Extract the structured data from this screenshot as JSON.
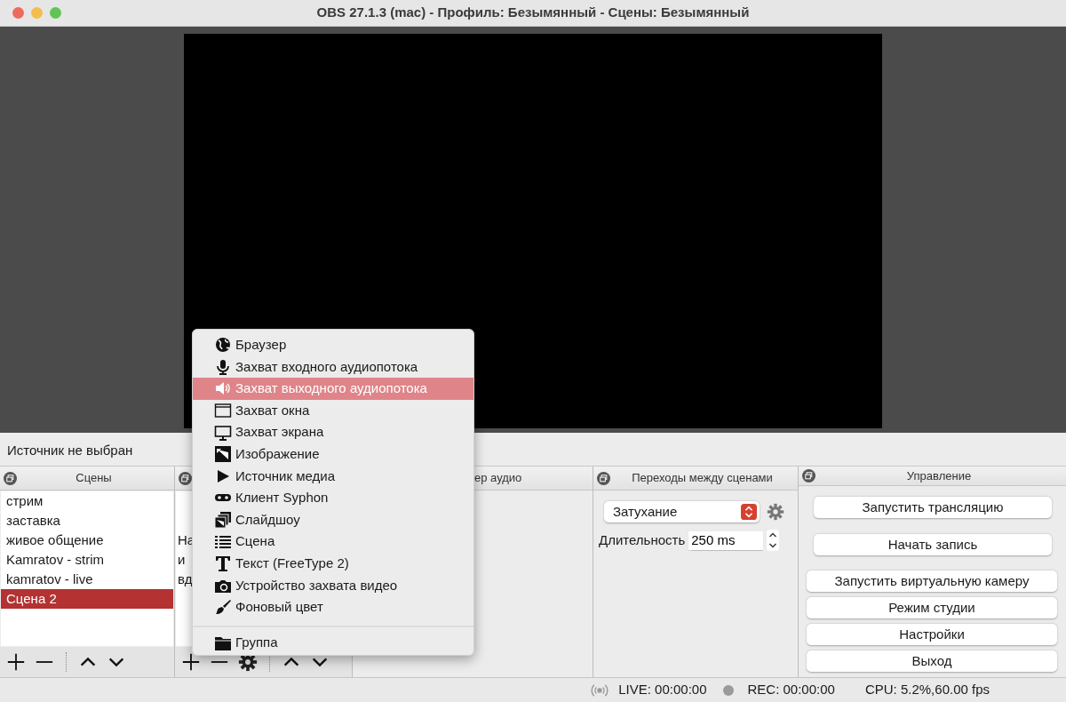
{
  "window": {
    "title": "OBS 27.1.3 (mac) - Профиль: Безымянный - Сцены: Безымянный"
  },
  "source_label": "Источник не выбран",
  "scenes": {
    "title": "Сцены",
    "items": [
      {
        "label": "стрим",
        "selected": false
      },
      {
        "label": "заставка",
        "selected": false
      },
      {
        "label": "живое общение",
        "selected": false
      },
      {
        "label": "Kamratov - strim",
        "selected": false
      },
      {
        "label": "kamratov - live",
        "selected": false
      },
      {
        "label": "Сцена 2",
        "selected": true
      }
    ]
  },
  "sources": {
    "lines": [
      "На",
      "и",
      "вд"
    ]
  },
  "mixer": {
    "title": "ер аудио"
  },
  "transitions": {
    "title": "Переходы между сценами",
    "transition": "Затухание",
    "duration_label": "Длительность",
    "duration_value": "250 ms"
  },
  "controls": {
    "title": "Управление",
    "buttons": [
      "Запустить трансляцию",
      "Начать запись",
      "Запустить виртуальную камеру",
      "Режим студии",
      "Настройки",
      "Выход"
    ]
  },
  "context_menu": {
    "items": [
      {
        "label": "Браузер",
        "selected": false
      },
      {
        "label": "Захват входного аудиопотока",
        "selected": false
      },
      {
        "label": "Захват выходного аудиопотока",
        "selected": true
      },
      {
        "label": "Захват окна",
        "selected": false
      },
      {
        "label": "Захват экрана",
        "selected": false
      },
      {
        "label": "Изображение",
        "selected": false
      },
      {
        "label": "Источник медиа",
        "selected": false
      },
      {
        "label": "Клиент Syphon",
        "selected": false
      },
      {
        "label": "Слайдшоу",
        "selected": false
      },
      {
        "label": "Сцена",
        "selected": false
      },
      {
        "label": "Текст (FreeType 2)",
        "selected": false
      },
      {
        "label": "Устройство захвата видео",
        "selected": false
      },
      {
        "label": "Фоновый цвет",
        "selected": false
      }
    ],
    "extra_items": [
      {
        "label": "Группа",
        "selected": false
      }
    ]
  },
  "status_bar": {
    "live": "LIVE: 00:00:00",
    "rec": "REC: 00:00:00",
    "cpu": "CPU: 5.2%,60.00 fps"
  }
}
